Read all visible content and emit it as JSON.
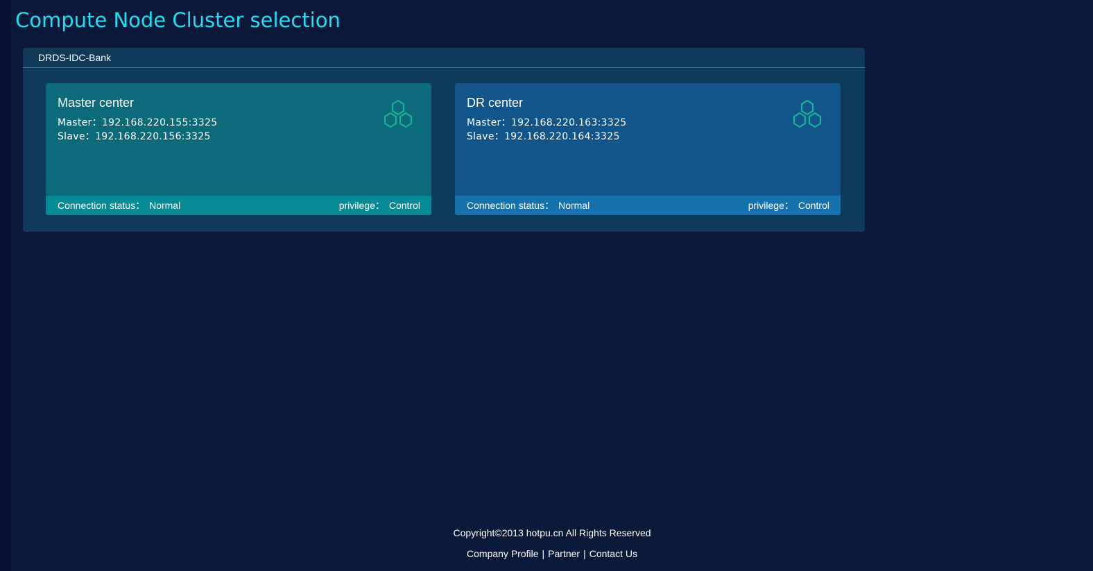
{
  "page": {
    "title": "Compute Node Cluster selection"
  },
  "group": {
    "name": "DRDS-IDC-Bank",
    "cards": [
      {
        "name": "Master center",
        "master_label": "Master：",
        "master_value": "192.168.220.155:3325",
        "slave_label": "Slave：",
        "slave_value": "192.168.220.156:3325",
        "status_label": "Connection status：",
        "status_value": "Normal",
        "privilege_label": "privilege：",
        "privilege_value": "Control",
        "icon": "hexagon-cluster-icon"
      },
      {
        "name": "DR center",
        "master_label": "Master：",
        "master_value": "192.168.220.163:3325",
        "slave_label": "Slave：",
        "slave_value": "192.168.220.164:3325",
        "status_label": "Connection status：",
        "status_value": "Normal",
        "privilege_label": "privilege：",
        "privilege_value": "Control",
        "icon": "hexagon-cluster-icon"
      }
    ]
  },
  "footer": {
    "copyright": "Copyright©2013 hotpu.cn All Rights Reserved",
    "links": [
      "Company Profile",
      "Partner",
      "Contact Us"
    ],
    "separator": "|"
  },
  "colors": {
    "background": "#0a183a",
    "title": "#1ee0f2",
    "panel": "#0f3a5a",
    "master_card": "#0d6a7a",
    "master_footer": "#058a96",
    "dr_card": "#12558a",
    "dr_footer": "#1572ad",
    "icon": "#1ab394"
  }
}
